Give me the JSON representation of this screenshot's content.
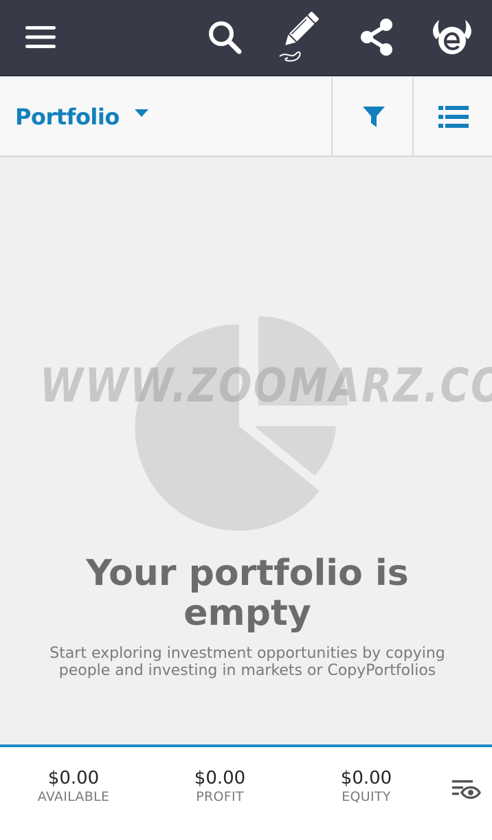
{
  "toolbar": {
    "icons": [
      "menu-icon",
      "search-icon",
      "edit-icon",
      "share-icon",
      "etoro-logo"
    ],
    "background": "#383b47"
  },
  "header": {
    "title": "Portfolio",
    "accent": "#1480bd",
    "icons": [
      "caret-down-icon",
      "filter-icon",
      "list-view-icon"
    ]
  },
  "empty_state": {
    "title": "Your portfolio is empty",
    "subtitle": "Start exploring investment opportunities by copying people and investing in markets or CopyPortfolios",
    "icon": "pie-chart-icon"
  },
  "watermark": {
    "text": "WWW.ZOOMARZ.COM"
  },
  "footer": {
    "accent": "#1c87c9",
    "stats": [
      {
        "value": "$0.00",
        "label": "AVAILABLE"
      },
      {
        "value": "$0.00",
        "label": "PROFIT"
      },
      {
        "value": "$0.00",
        "label": "EQUITY"
      }
    ],
    "icons": [
      "view-options-icon"
    ]
  }
}
